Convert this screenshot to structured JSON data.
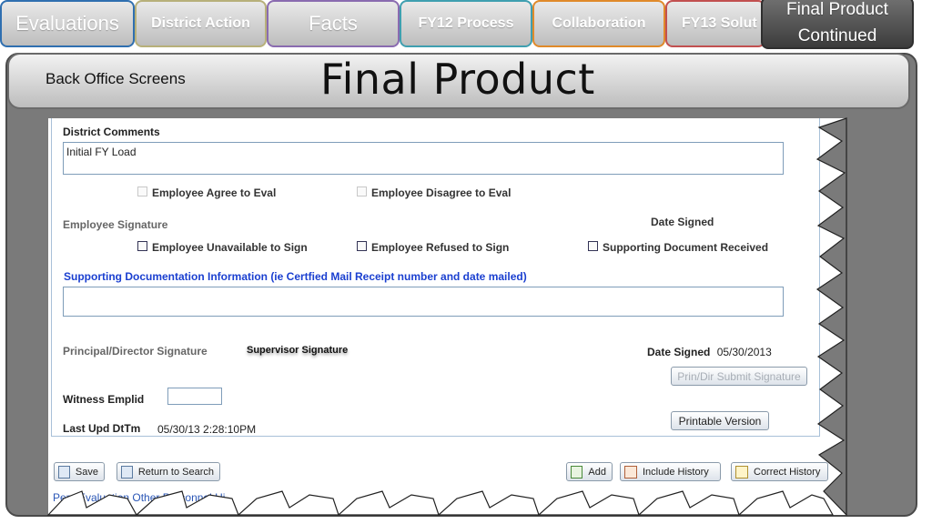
{
  "tabs": [
    {
      "label": "Evaluations"
    },
    {
      "label": "District Action"
    },
    {
      "label": "Facts"
    },
    {
      "label": "FY12 Process"
    },
    {
      "label": "Collaboration"
    },
    {
      "label": "FY13 Solut"
    },
    {
      "label": "Final Product Continued"
    }
  ],
  "tab_colors": [
    "#2f6fb0",
    "#b7b07a",
    "#8a6bb0",
    "#3f9fb0",
    "#e08a2a",
    "#c25050",
    "#2f2f2f"
  ],
  "header": {
    "subtitle": "Back Office Screens",
    "title": "Final Product"
  },
  "form": {
    "district_comments_label": "District Comments",
    "district_comments_value": "Initial FY Load",
    "agree_label": "Employee Agree to Eval",
    "disagree_label": "Employee Disagree to Eval",
    "employee_signature_label": "Employee Signature",
    "date_signed_label": "Date Signed",
    "unavailable_label": "Employee Unavailable to Sign",
    "refused_label": "Employee Refused to Sign",
    "supporting_received_label": "Supporting Document Received",
    "supporting_info_label": "Supporting Documentation Information (ie Certfied Mail Receipt number and date mailed)",
    "principal_signature_label": "Principal/Director Signature",
    "supervisor_signature": "Supervisor Signature",
    "date_signed2_label": "Date Signed",
    "date_signed2_value": "05/30/2013",
    "prin_submit_button": "Prin/Dir Submit Signature",
    "witness_label": "Witness Emplid",
    "printable_button": "Printable Version",
    "last_upd_label": "Last Upd DtTm",
    "last_upd_value": "05/30/13  2:28:10PM"
  },
  "toolbar": {
    "save": "Save",
    "return": "Return to Search",
    "add": "Add",
    "include_history": "Include History",
    "correct_history": "Correct History"
  },
  "bottom_link": "Pers Evaluation Other Personnel Hi"
}
